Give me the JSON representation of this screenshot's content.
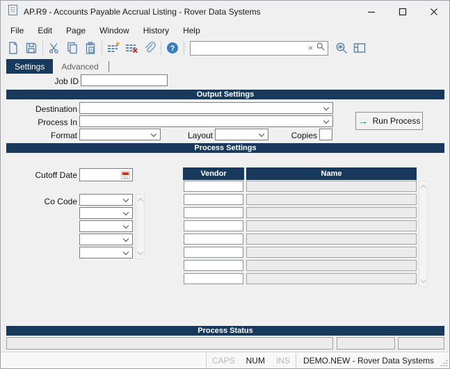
{
  "window": {
    "title": "AP.R9 - Accounts Payable Accrual Listing - Rover Data Systems"
  },
  "menu": {
    "items": [
      "File",
      "Edit",
      "Page",
      "Window",
      "History",
      "Help"
    ]
  },
  "toolbar": {
    "search_value": ""
  },
  "tabs": {
    "settings": "Settings",
    "advanced": "Advanced"
  },
  "job": {
    "label": "Job ID",
    "value": ""
  },
  "output": {
    "header": "Output Settings",
    "destination": {
      "label": "Destination",
      "value": ""
    },
    "process_in": {
      "label": "Process In",
      "value": ""
    },
    "format": {
      "label": "Format",
      "value": ""
    },
    "layout": {
      "label": "Layout",
      "value": ""
    },
    "copies": {
      "label": "Copies",
      "value": ""
    },
    "run_button": "Run Process"
  },
  "process": {
    "header": "Process Settings",
    "cutoff": {
      "label": "Cutoff Date",
      "value": ""
    },
    "co_code": {
      "label": "Co Code",
      "count": 5
    },
    "vendor_table": {
      "columns": [
        "Vendor",
        "Name"
      ],
      "row_count": 8
    }
  },
  "status_section": {
    "header": "Process Status"
  },
  "statusbar": {
    "caps": "CAPS",
    "num": "NUM",
    "ins": "INS",
    "connection": "DEMO.NEW - Rover Data Systems"
  },
  "colors": {
    "header_bar": "#17395b",
    "run_arrow_green": "#1f9e3e",
    "icon_blue": "#5f87ab"
  }
}
